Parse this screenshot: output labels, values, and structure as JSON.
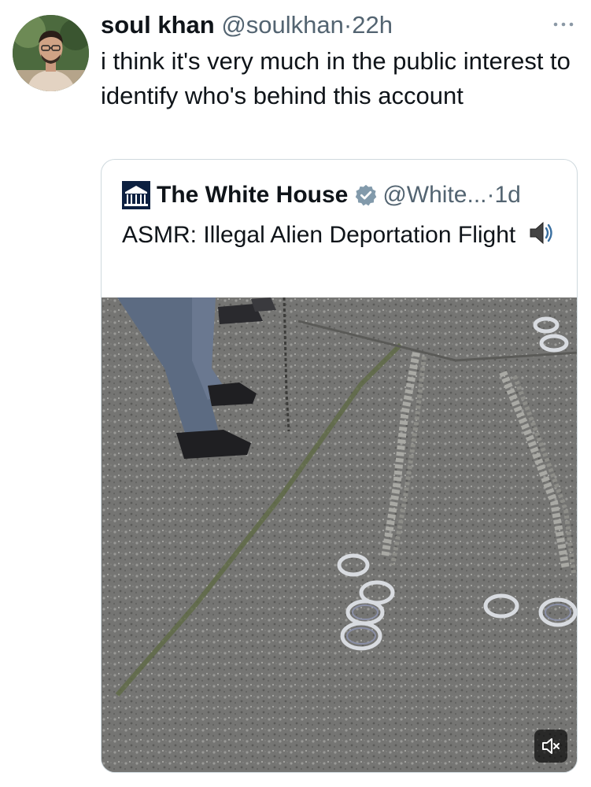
{
  "post": {
    "author_name": "soul khan",
    "handle": "@soulkhan",
    "separator": "·",
    "time": "22h",
    "text": "i think it's very much in the public interest to identify who's behind this account",
    "more_icon": "more-horizontal-icon"
  },
  "quote": {
    "author_name": "The White House",
    "handle": "@White...",
    "separator": "·",
    "time": "1d",
    "verified_color": "#829aab",
    "text": "ASMR: Illegal Alien Deportation Flight",
    "emoji_icon": "speaker-loud-icon",
    "media": {
      "type": "video",
      "description_icon": "video-thumbnail",
      "mute_icon": "volume-muted-icon"
    }
  },
  "colors": {
    "text_primary": "#0f1419",
    "text_secondary": "#536471",
    "border": "#cfd9de"
  }
}
